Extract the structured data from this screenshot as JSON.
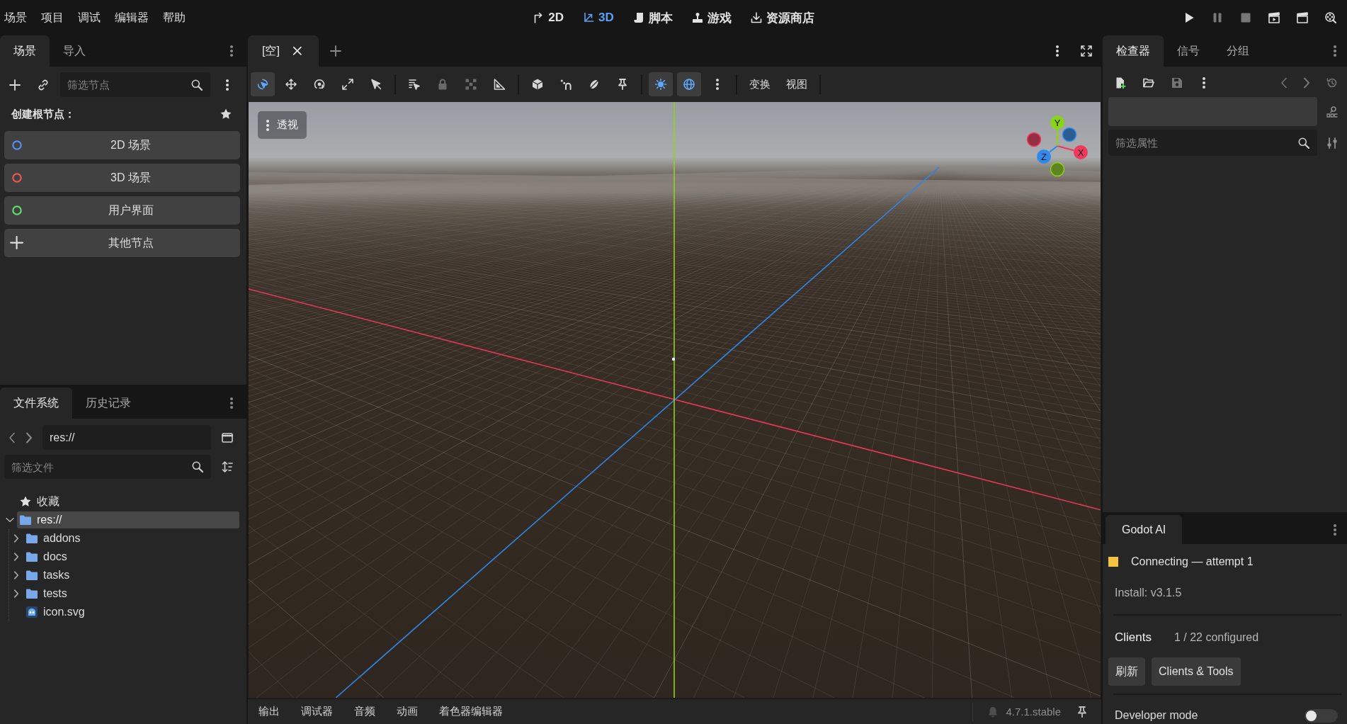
{
  "menu_bar": {
    "menus": [
      "场景",
      "项目",
      "调试",
      "编辑器",
      "帮助"
    ],
    "workspaces": [
      {
        "label": "2D",
        "kind": "canvas",
        "selected": false
      },
      {
        "label": "3D",
        "kind": "spatial",
        "selected": true
      },
      {
        "label": "脚本",
        "kind": "script",
        "selected": false
      },
      {
        "label": "游戏",
        "kind": "game",
        "selected": false
      },
      {
        "label": "资源商店",
        "kind": "assetlib",
        "selected": false
      }
    ],
    "run_buttons": [
      {
        "kind": "play",
        "disabled": false
      },
      {
        "kind": "pause",
        "disabled": true
      },
      {
        "kind": "stop",
        "disabled": true
      },
      {
        "kind": "play_scene",
        "disabled": false
      },
      {
        "kind": "play_custom",
        "disabled": false
      },
      {
        "kind": "movie_maker",
        "disabled": false
      }
    ]
  },
  "scene_dock": {
    "tabs": [
      {
        "label": "场景",
        "selected": true
      },
      {
        "label": "导入",
        "selected": false
      }
    ],
    "filter": {
      "placeholder": "筛选节点"
    },
    "create_root": {
      "title": "创建根节点：",
      "options": [
        {
          "label": "2D 场景",
          "kind": "node",
          "color": "#5b8cf0"
        },
        {
          "label": "3D 场景",
          "kind": "node",
          "color": "#e85858"
        },
        {
          "label": "用户界面",
          "kind": "node",
          "color": "#5ee070"
        },
        {
          "label": "其他节点",
          "kind": "add"
        }
      ]
    }
  },
  "filesystem_dock": {
    "tabs": [
      {
        "label": "文件系统",
        "selected": true
      },
      {
        "label": "历史记录",
        "selected": false
      }
    ],
    "path": {
      "value": "res://"
    },
    "filter": {
      "placeholder": "筛选文件"
    },
    "tree": [
      {
        "label": "收藏",
        "kind": "favorites",
        "selected": false
      },
      {
        "label": "res://",
        "kind": "folder",
        "expanded": true,
        "selected": true,
        "children": [
          {
            "label": "addons",
            "kind": "folder",
            "expanded": false,
            "selected": false
          },
          {
            "label": "docs",
            "kind": "folder",
            "expanded": false,
            "selected": false
          },
          {
            "label": "tasks",
            "kind": "folder",
            "expanded": false,
            "selected": false
          },
          {
            "label": "tests",
            "kind": "folder",
            "expanded": false,
            "selected": false
          },
          {
            "label": "icon.svg",
            "kind": "file",
            "selected": false
          }
        ]
      }
    ]
  },
  "editor": {
    "tabs": [
      {
        "label": "[空]",
        "selected": true
      }
    ],
    "toolbar": {
      "tool_groups": [
        {
          "tools": [
            {
              "kind": "select",
              "active": true,
              "disabled": false
            },
            {
              "kind": "move",
              "active": false,
              "disabled": false
            },
            {
              "kind": "rotate",
              "active": false,
              "disabled": false
            },
            {
              "kind": "scale",
              "active": false,
              "disabled": false
            },
            {
              "kind": "pointer",
              "active": false,
              "disabled": false
            }
          ]
        },
        {
          "tools": [
            {
              "kind": "list_select",
              "active": false,
              "disabled": false
            },
            {
              "kind": "lock",
              "active": false,
              "disabled": true
            },
            {
              "kind": "group",
              "active": false,
              "disabled": true
            },
            {
              "kind": "ruler",
              "active": false,
              "disabled": false
            }
          ]
        },
        {
          "tools": [
            {
              "kind": "cube",
              "active": false,
              "disabled": false
            },
            {
              "kind": "snap",
              "active": false,
              "disabled": false
            },
            {
              "kind": "planet",
              "active": false,
              "disabled": false
            },
            {
              "kind": "pin",
              "active": false,
              "disabled": false
            }
          ]
        },
        {
          "tools": [
            {
              "kind": "sun",
              "active": true,
              "disabled": false
            },
            {
              "kind": "globe",
              "active": true,
              "disabled": false
            },
            {
              "kind": "more",
              "active": false,
              "disabled": false
            }
          ]
        }
      ],
      "menus": [
        "变换",
        "视图"
      ]
    },
    "viewport": {
      "view_menu": "透视",
      "gizmo": [
        {
          "label": "X",
          "color": "#f0395c"
        },
        {
          "label": "Y",
          "color": "#8bd21b"
        },
        {
          "label": "Z",
          "color": "#2e8bec"
        }
      ]
    },
    "bottom_panel": {
      "tabs": [
        {
          "label": "输出",
          "selected": false
        },
        {
          "label": "调试器",
          "selected": false
        },
        {
          "label": "音频",
          "selected": false
        },
        {
          "label": "动画",
          "selected": false
        },
        {
          "label": "着色器编辑器",
          "selected": false
        }
      ],
      "version": "4.7.1.stable"
    }
  },
  "inspector_dock": {
    "tabs": [
      {
        "label": "检查器",
        "selected": true
      },
      {
        "label": "信号",
        "selected": false
      },
      {
        "label": "分组",
        "selected": false
      }
    ],
    "toolbar": [
      {
        "kind": "new_resource",
        "disabled": false
      },
      {
        "kind": "open",
        "disabled": false
      },
      {
        "kind": "save",
        "disabled": true
      },
      {
        "kind": "more",
        "disabled": false
      },
      {
        "kind": "back",
        "disabled": true
      },
      {
        "kind": "forward",
        "disabled": true
      },
      {
        "kind": "history",
        "disabled": true
      }
    ],
    "filter": {
      "placeholder": "筛选属性"
    }
  },
  "ai_dock": {
    "tabs": [
      {
        "label": "Godot AI",
        "selected": true
      }
    ],
    "status": {
      "color": "#f5c242",
      "text": "Connecting — attempt 1"
    },
    "install": "Install: v3.1.5",
    "clients": {
      "label": "Clients",
      "summary": "1 / 22 configured"
    },
    "buttons": [
      "刷新",
      "Clients & Tools"
    ],
    "developer_mode": {
      "label": "Developer mode",
      "on": false
    }
  }
}
